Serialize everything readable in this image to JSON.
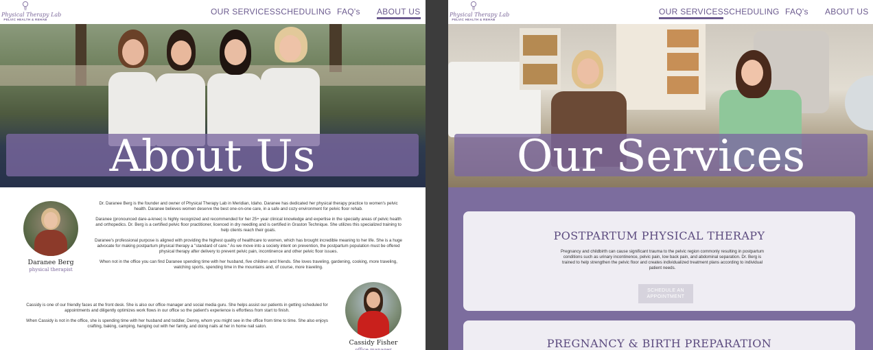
{
  "logo": {
    "script": "Physical Therapy Lab",
    "subtitle": "PELVIC HEALTH & REHAB"
  },
  "nav": [
    "OUR SERVICES",
    "SCHEDULING",
    "FAQ's",
    "ABOUT US"
  ],
  "about_page": {
    "active_nav": "ABOUT US",
    "banner": "About Us",
    "staff": [
      {
        "name": "Daranee Berg",
        "role": "physical therapist",
        "paragraphs": [
          "Dr. Daranee Berg is the founder and owner of Physical Therapy Lab in Meridian, Idaho. Daranee has dedicated her physical therapy practice to women's pelvic health. Daranee believes women deserve the best one-on-one care, in a safe and cozy environment for pelvic floor rehab.",
          "Daranee (pronounced dare-a-knee) is highly recognized and recommended for her 25+ year clinical knowledge and expertise in the specialty areas of pelvic health and orthopedics. Dr. Berg is a certified pelvic floor practitioner, licenced in dry needling and is certified in Graston Technique. She utilizes this specialized training to help clients reach their goals.",
          "Daranee's professional purpose is aligned with providing the highest quality of healthcare to women, which has brought incredible meaning to her life. She is a huge advocate for making postpartum physical therapy a \"standard of care.\" As we move into a society intent on prevention, the postpartum population must be offered physical therapy after delivery to prevent pelvic pain, incontinence and other pelvic floor issues.",
          "When not in the office you can find Daranee spending time with her husband, five children and friends. She loves traveling, gardening, cooking, more traveling, watching sports, spending time in the mountains and, of course, more traveling."
        ]
      },
      {
        "name": "Cassidy Fisher",
        "role": "office manager",
        "paragraphs": [
          "Cassidy is one of our friendly faces at the front desk. She is also our office manager and social media guru. She helps assist our patients in getting scheduled for appointments and diligently optimizes work flows in our office so the patient's experience is effortless from start to finish.",
          "When Cassidy is not in the office, she is spending time with her husband and toddler, Denny, whom you might see in the office from time to time. She also enjoys crafting, baking, camping, hanging out with her family, and doing nails at her in home nail salon."
        ]
      }
    ]
  },
  "services_page": {
    "active_nav": "OUR SERVICES",
    "banner": "Our Services",
    "cards": [
      {
        "title": "POSTPARTUM PHYSICAL THERAPY",
        "description": "Pregnancy and childbirth can cause significant trauma to the pelvic region commonly resulting in postpartum conditions such as urinary incontinence, pelvic pain, low back pain, and abdominal separation. Dr. Berg is trained to help strengthen the pelvic floor and creates individualized treatment plans according to individual patient needs.",
        "button": "SCHEDULE AN APPOINTMENT"
      },
      {
        "title": "PREGNANCY & BIRTH PREPARATION"
      }
    ]
  },
  "colors": {
    "brand_purple": "#6b5a8e",
    "banner_purple": "#7b68a0",
    "section_purple": "#7c6d9e"
  }
}
